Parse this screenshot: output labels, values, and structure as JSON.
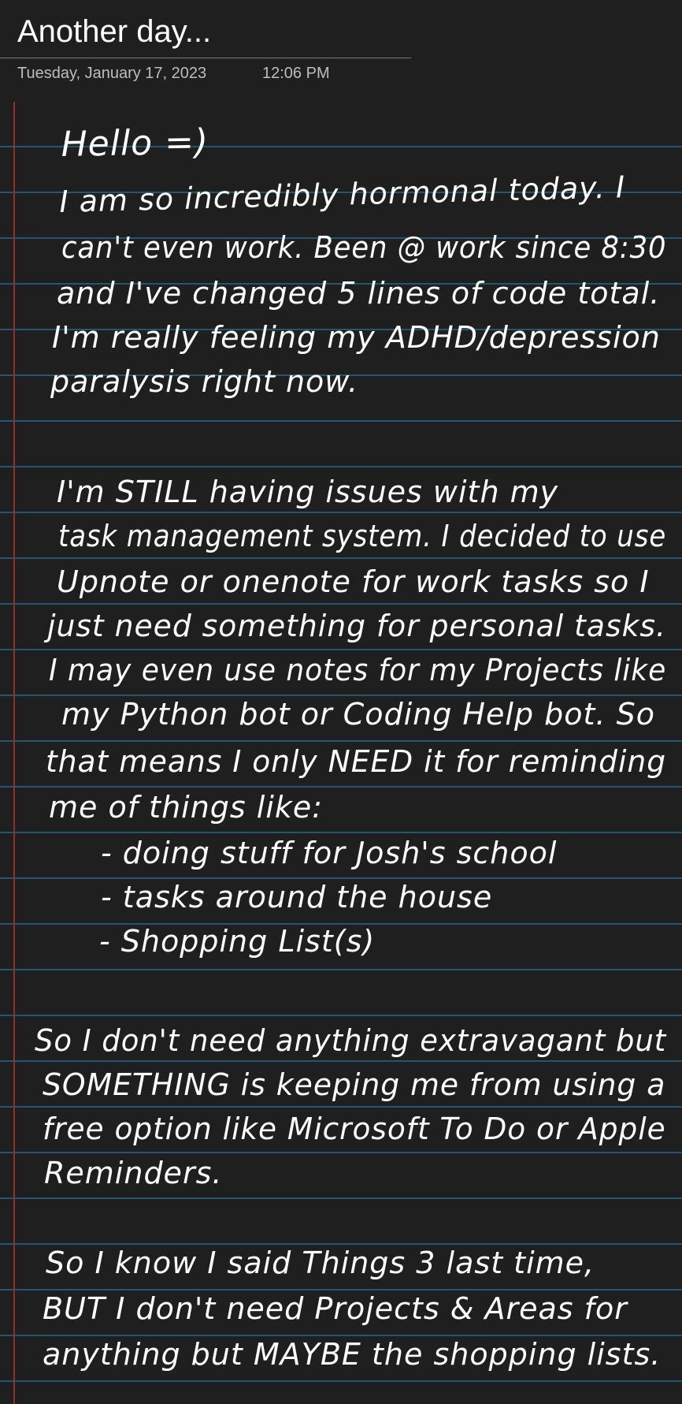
{
  "page": {
    "title": "Another day...",
    "date": "Tuesday, January 17, 2023",
    "time": "12:06 PM"
  },
  "ink_lines": [
    "Hello =)",
    "I am so incredibly hormonal today. I",
    "can't even work. Been @ work since 8:30",
    "and I've changed 5 lines of code total.",
    "I'm really feeling my ADHD/depression",
    "paralysis right now.",
    "I'm STILL having issues with my",
    "task management system. I decided to use",
    "Upnote or onenote for work tasks so I",
    "just need something for personal tasks.",
    "I may even use notes for my Projects like",
    "my Python bot or Coding Help bot. So",
    "that means I only NEED it for reminding",
    "me of things like:",
    "- doing stuff for Josh's school",
    "- tasks around the house",
    "- Shopping List(s)",
    "So I don't need anything extravagant but",
    "SOMETHING is keeping me from using a",
    "free option like Microsoft To Do or Apple",
    "Reminders.",
    "So I know I said Things 3 last time,",
    "BUT I don't need Projects & Areas for",
    "anything but MAYBE the shopping lists."
  ],
  "colors": {
    "background": "#1f1f1f",
    "rule_line": "#1f5873",
    "margin_line": "#9b2a2a",
    "ink": "#ffffff",
    "meta_text": "#bdbdbd"
  }
}
